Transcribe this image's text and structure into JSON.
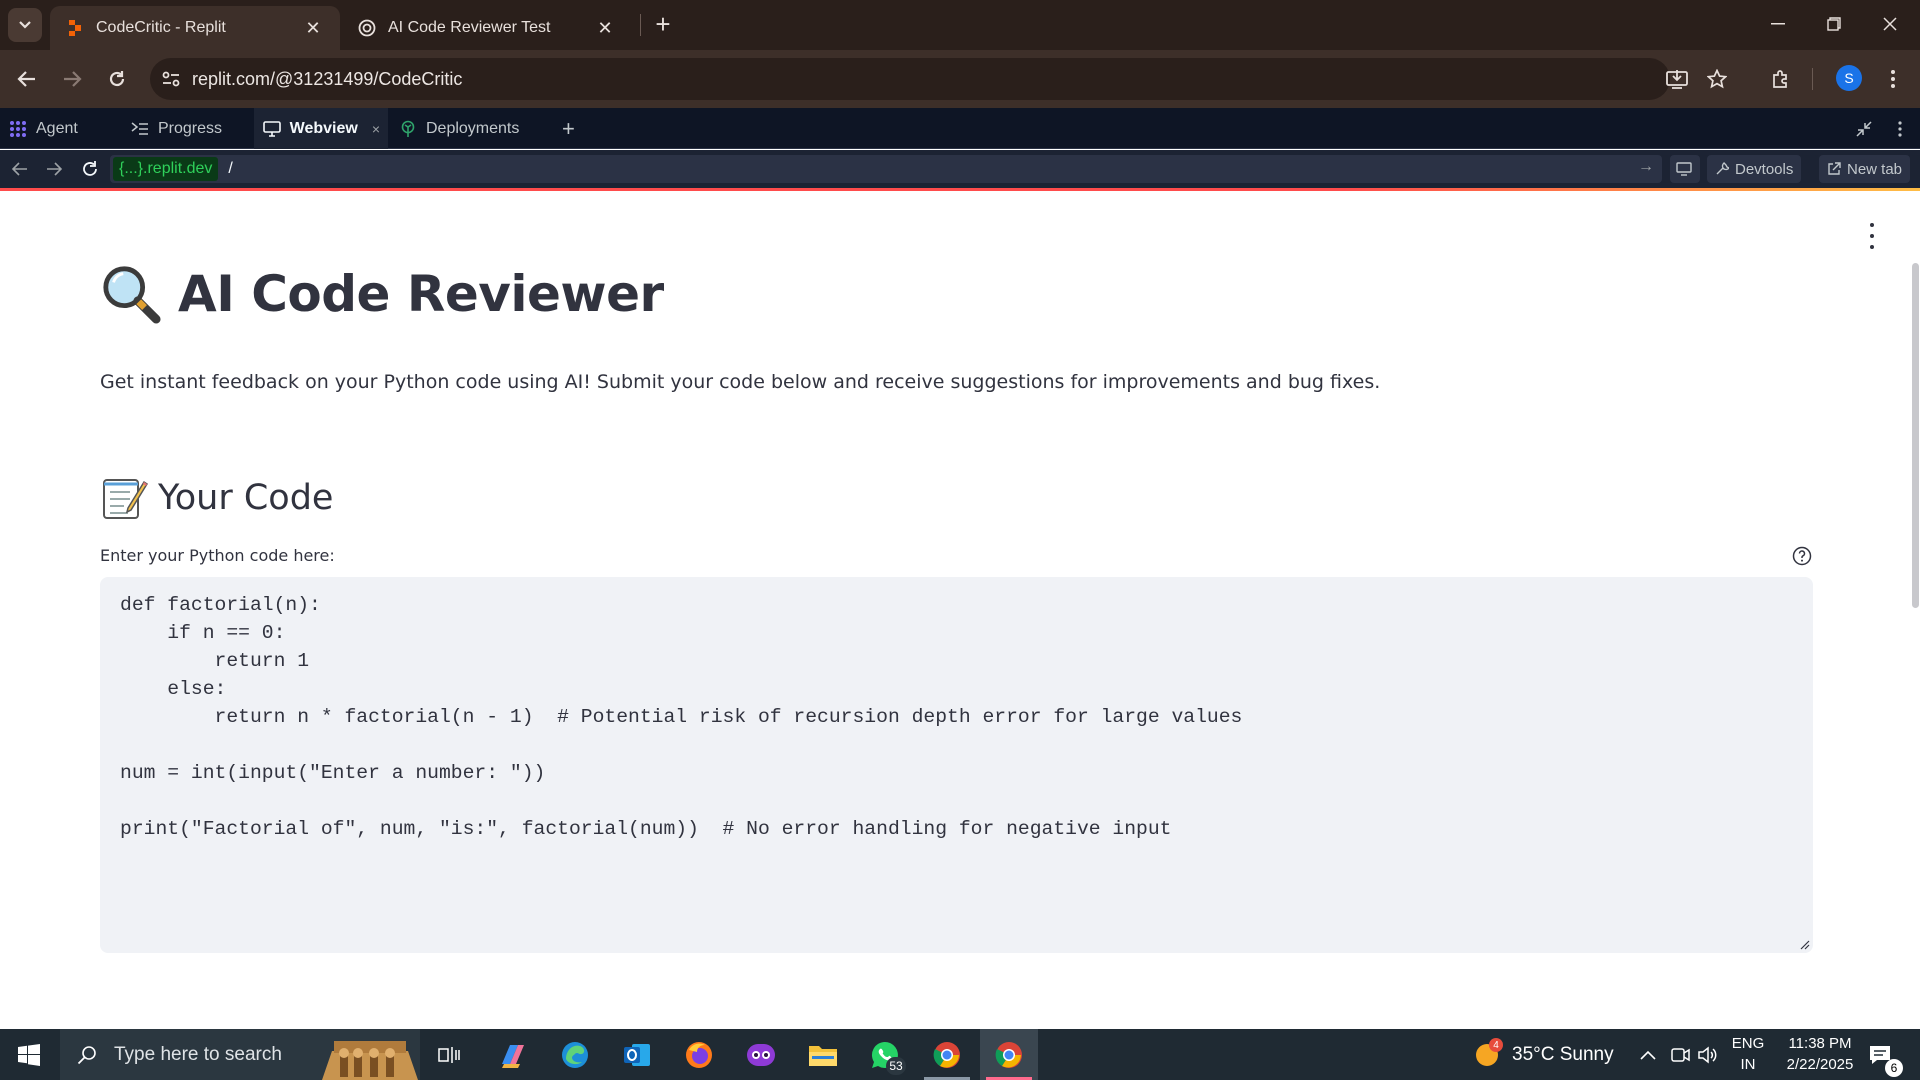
{
  "browser": {
    "tabs": [
      {
        "title": "CodeCritic - Replit",
        "favicon": "replit-icon",
        "active": true
      },
      {
        "title": "AI Code Reviewer Test",
        "favicon": "openai-icon",
        "active": false
      }
    ],
    "address": "replit.com/@31231499/CodeCritic",
    "profile_initial": "S"
  },
  "replit": {
    "tabs": [
      {
        "label": "Agent",
        "icon": "agent-icon"
      },
      {
        "label": "Progress",
        "icon": "progress-icon"
      },
      {
        "label": "Webview",
        "icon": "monitor-icon",
        "active": true,
        "close": "×"
      },
      {
        "label": "Deployments",
        "icon": "deployments-icon"
      }
    ],
    "webview": {
      "domain": "{...}.replit.dev",
      "path": "/",
      "devtools_label": "Devtools",
      "newtab_label": "New tab"
    }
  },
  "page": {
    "title": "AI Code Reviewer",
    "title_emoji": "magnifying-glass",
    "intro": "Get instant feedback on your Python code using AI! Submit your code below and receive suggestions for improvements and bug fixes.",
    "section_title": "Your Code",
    "section_emoji": "memo",
    "input_label": "Enter your Python code here:",
    "code_lines": [
      "def factorial(n):",
      "    if n == 0:",
      "        return 1",
      "    else:",
      "        return n * factorial(n - 1)  # Potential risk of recursion depth error for large values",
      "",
      "num = int(input(\"Enter a number: \"))",
      "",
      "print(\"Factorial of\", num, \"is:\", factorial(num))  # No error handling for negative input"
    ]
  },
  "taskbar": {
    "search_placeholder": "Type here to search",
    "whatsapp_badge": "53",
    "weather_badge": "4",
    "weather": "35°C  Sunny",
    "lang_top": "ENG",
    "lang_bottom": "IN",
    "time": "11:38 PM",
    "date": "2/22/2025",
    "notifications": "6"
  },
  "colors": {
    "chrome_bg": "#2a1f1b",
    "replit_bg": "#0e1525",
    "code_bg": "#f0f2f6",
    "text": "#31333f",
    "accent_red": "#ff4b4b"
  }
}
